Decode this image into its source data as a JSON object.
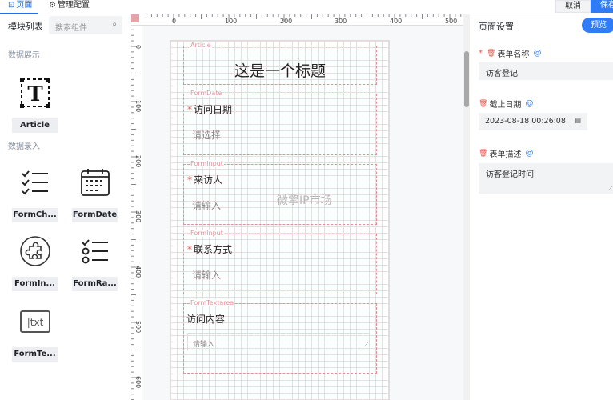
{
  "topbar": {
    "tab_pages": "页面",
    "tab_manage": "管理配置",
    "cancel_label": "取消",
    "save_label": "保存"
  },
  "left": {
    "title": "模块列表",
    "search_placeholder": "搜索组件",
    "group_display": "数据展示",
    "group_input": "数据录入",
    "components": {
      "article": "Article",
      "formcheckbox": "FormCh...",
      "formdate": "FormDate",
      "forminput": "FormIn...",
      "formradio": "FormRa...",
      "formtextarea": "FormTe..."
    },
    "textarea_icon_text": "|txt"
  },
  "rulers": {
    "h_ticks": [
      "0",
      "100",
      "200",
      "300",
      "400",
      "500"
    ],
    "v_ticks": [
      "0",
      "100",
      "200",
      "300",
      "400",
      "500",
      "600"
    ]
  },
  "canvas": {
    "article": {
      "tag": "Article",
      "title": "这是一个标题"
    },
    "date": {
      "tag": "FormDate",
      "required": "*",
      "label": "访问日期",
      "placeholder": "请选择"
    },
    "visitor": {
      "tag": "FormInput",
      "required": "*",
      "label": "来访人",
      "placeholder": "请输入"
    },
    "contact": {
      "tag": "FormInput",
      "required": "*",
      "label": "联系方式",
      "placeholder": "请输入"
    },
    "content": {
      "tag": "FormTextarea",
      "label": "访问内容",
      "placeholder": "请输入"
    },
    "watermark": "微擎IP市场"
  },
  "right": {
    "title": "页面设置",
    "preview_label": "预览",
    "form_name_label": "表单名称",
    "form_name_value": "访客登记",
    "deadline_label": "截止日期",
    "deadline_value": "2023-08-18 00:26:08",
    "desc_label": "表单描述",
    "desc_value": "访客登记时间",
    "at_symbol": "@",
    "required_mark": "*"
  },
  "colors": {
    "accent": "#2f7cf6",
    "guide": "#e4919a",
    "required": "#e4564b"
  }
}
